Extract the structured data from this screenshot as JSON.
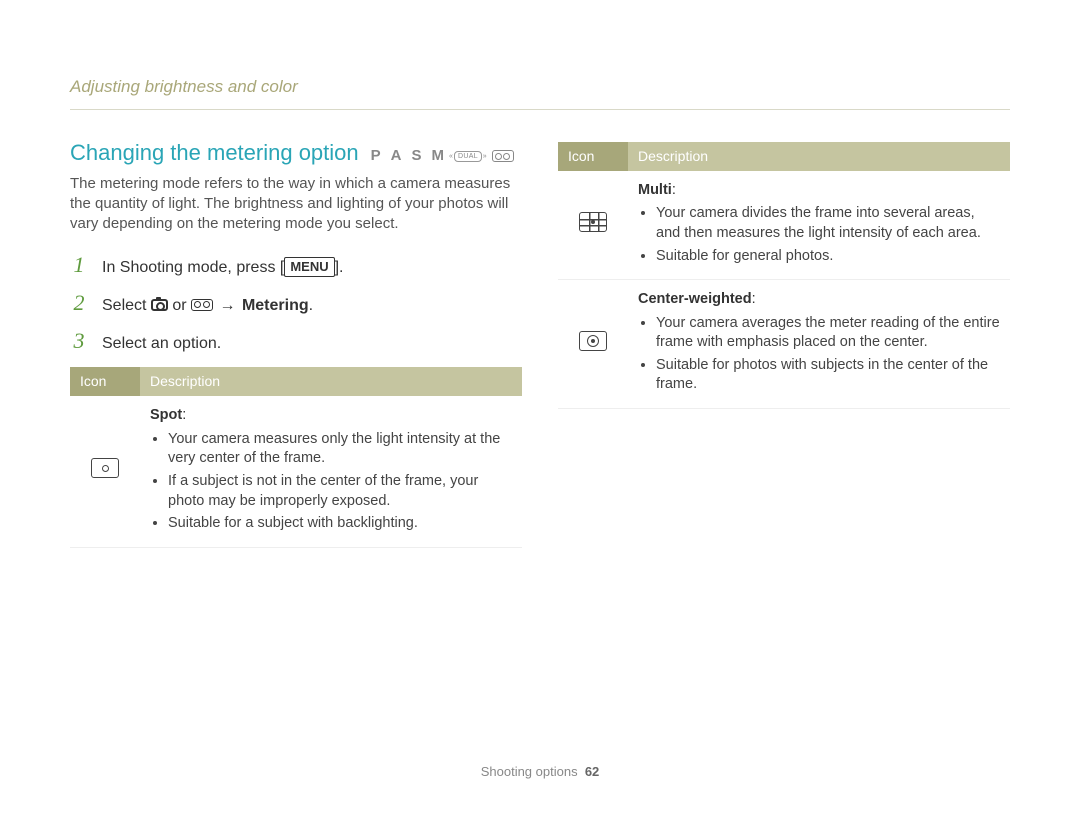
{
  "header": {
    "topic": "Adjusting brightness and color"
  },
  "left": {
    "title": "Changing the metering option",
    "modes": {
      "p": "P",
      "a": "A",
      "s": "S",
      "m": "M",
      "dual": "DUAL"
    },
    "intro": "The metering mode refers to the way in which a camera measures the quantity of light. The brightness and lighting of your photos will vary depending on the metering mode you select.",
    "steps": {
      "s1a": "In Shooting mode, press [",
      "s1menu": "MENU",
      "s1b": "].",
      "s2a": "Select ",
      "s2or": " or ",
      "s2arrow": "→ ",
      "s2metering": "Metering",
      "s2end": ".",
      "s3": "Select an option."
    },
    "table": {
      "h_icon": "Icon",
      "h_desc": "Description",
      "spot_title": "Spot",
      "spot_b1": "Your camera measures only the light intensity at the very center of the frame.",
      "spot_b2": "If a subject is not in the center of the frame, your photo may be improperly exposed.",
      "spot_b3": "Suitable for a subject with backlighting."
    }
  },
  "right": {
    "h_icon": "Icon",
    "h_desc": "Description",
    "multi_title": "Multi",
    "multi_b1": "Your camera divides the frame into several areas, and then measures the light intensity of each area.",
    "multi_b2": "Suitable for general photos.",
    "cw_title": "Center-weighted",
    "cw_b1": "Your camera averages the meter reading of the entire frame with emphasis placed on the center.",
    "cw_b2": "Suitable for photos with subjects in the center of the frame."
  },
  "footer": {
    "section": "Shooting options",
    "page": "62"
  }
}
